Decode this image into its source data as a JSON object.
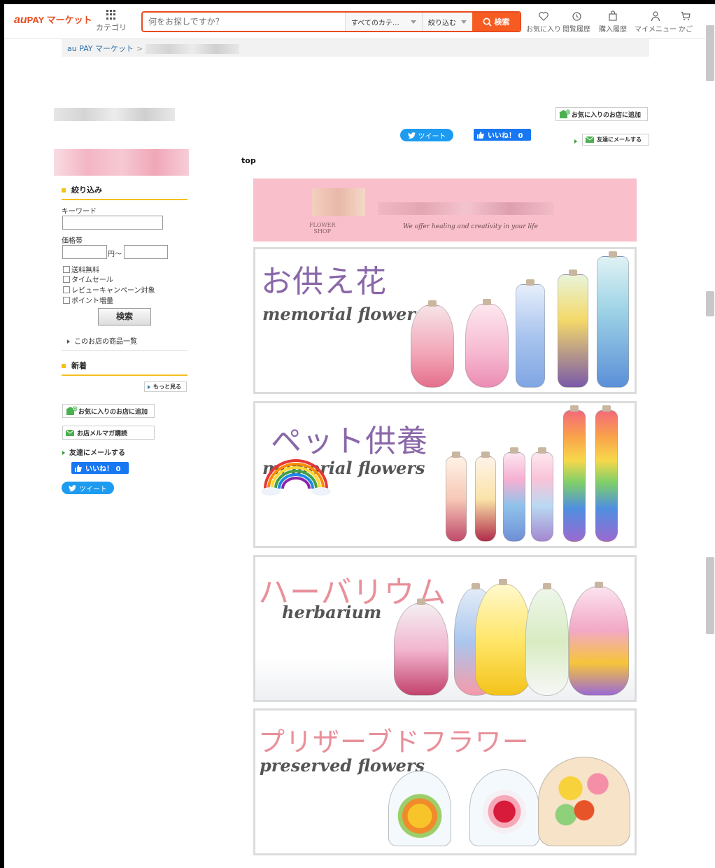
{
  "header": {
    "logo_au": "au",
    "logo_text": "PAY マーケット",
    "category_label": "カテゴリ",
    "search_placeholder": "何をお探しですか？",
    "category_select": "すべてのカテ…",
    "refine_select": "絞り込む",
    "search_button": "検索",
    "nav": [
      "お気に入り",
      "閲覧履歴",
      "購入履歴",
      "マイメニュー",
      "かご"
    ]
  },
  "breadcrumb": {
    "home": "au PAY マーケット",
    "separator": ">"
  },
  "shop_actions": {
    "favorite": "お気に入りのお店に追加",
    "tweet": "ツイート",
    "like": "いいね！ 0",
    "mail_friend": "友達にメールする"
  },
  "sidebar": {
    "filter_title": "絞り込み",
    "keyword_label": "キーワード",
    "price_label": "価格帯",
    "price_sep": "円〜",
    "checkboxes": [
      "送料無料",
      "タイムセール",
      "レビューキャンペーン対象",
      "ポイント増量"
    ],
    "search_button": "検索",
    "all_items_link": "このお店の商品一覧",
    "new_title": "新着",
    "more_button": "もっと見る",
    "favorite_shop": "お気に入りのお店に追加",
    "mailmag": "お店メルマガ購読",
    "mail_friend": "友達にメールする",
    "like": "いいね！ 0",
    "tweet": "ツイート"
  },
  "main": {
    "top_label": "top",
    "shop_seal_1": "FLOWER",
    "shop_seal_2": "SHOP",
    "shop_tagline": "We offer healing and creativity in your life",
    "banners": [
      {
        "jp": "お供え花",
        "en": "memorial flowers",
        "color": "#8a67a8"
      },
      {
        "jp": "ペット供養",
        "en": "memorial flowers",
        "color": "#8a67a8"
      },
      {
        "jp": "ハーバリウム",
        "en": "herbarium",
        "color": "#e8909a"
      },
      {
        "jp": "プリザーブドフラワー",
        "en": "preserved flowers",
        "color": "#e8909a"
      }
    ]
  },
  "colors": {
    "accent": "#e94b1e",
    "search_btn": "#f65c22",
    "section_bar": "#f5c01c",
    "header_pink": "#f9bfcb",
    "facebook": "#1877f2",
    "twitter": "#1d9bf0"
  }
}
